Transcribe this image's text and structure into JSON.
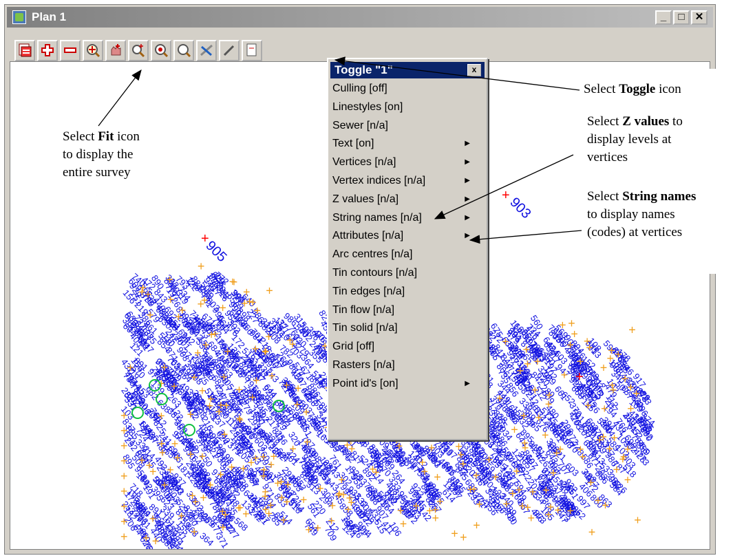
{
  "window": {
    "title": "Plan 1",
    "minimize": "_",
    "maximize": "□",
    "close": "✕"
  },
  "toolbar": {
    "buttons": [
      "layers",
      "zoom-in",
      "zoom-out",
      "fit",
      "pan",
      "zoom-window",
      "zoom-center",
      "zoom-select",
      "toggle",
      "pencil",
      "export"
    ]
  },
  "menu": {
    "title": "Toggle \"1\"",
    "close": "x",
    "items": [
      {
        "label": "Culling [off]",
        "submenu": false
      },
      {
        "label": "Linestyles [on]",
        "submenu": false
      },
      {
        "label": "Sewer [n/a]",
        "submenu": false
      },
      {
        "label": "Text [on]",
        "submenu": true
      },
      {
        "label": "Vertices [n/a]",
        "submenu": true
      },
      {
        "label": "Vertex indices [n/a]",
        "submenu": true
      },
      {
        "label": "Z values [n/a]",
        "submenu": true
      },
      {
        "label": "String names [n/a]",
        "submenu": true
      },
      {
        "label": "Attributes [n/a]",
        "submenu": true
      },
      {
        "label": "Arc centres [n/a]",
        "submenu": false
      },
      {
        "label": "Tin contours [n/a]",
        "submenu": false
      },
      {
        "label": "Tin edges [n/a]",
        "submenu": false
      },
      {
        "label": "Tin flow [n/a]",
        "submenu": false
      },
      {
        "label": "Tin solid [n/a]",
        "submenu": false
      },
      {
        "label": "Grid [off]",
        "submenu": false
      },
      {
        "label": "Rasters [n/a]",
        "submenu": false
      },
      {
        "label": "Point id's [on]",
        "submenu": true
      }
    ]
  },
  "plan_labels": {
    "p905": "905",
    "p903": "903",
    "p913": "913"
  },
  "annotations": {
    "fit": {
      "l1a": "Select ",
      "l1b": "Fit",
      "l1c": " icon",
      "l2": "to display the",
      "l3": "entire survey"
    },
    "toggle": {
      "a": "Select ",
      "b": "Toggle",
      "c": " icon"
    },
    "zvalues": {
      "l1a": "Select ",
      "l1b": "Z values",
      "l1c": " to",
      "l2": "display levels at",
      "l3": "vertices"
    },
    "strings": {
      "l1a": "Select ",
      "l1b": "String names",
      "l2": "to display names",
      "l3": "(codes) at vertices"
    }
  },
  "colors": {
    "survey_blue": "#1010e0",
    "point_orange": "#f0a020",
    "accent_green": "#10c040",
    "marker_red": "#ff0000"
  }
}
